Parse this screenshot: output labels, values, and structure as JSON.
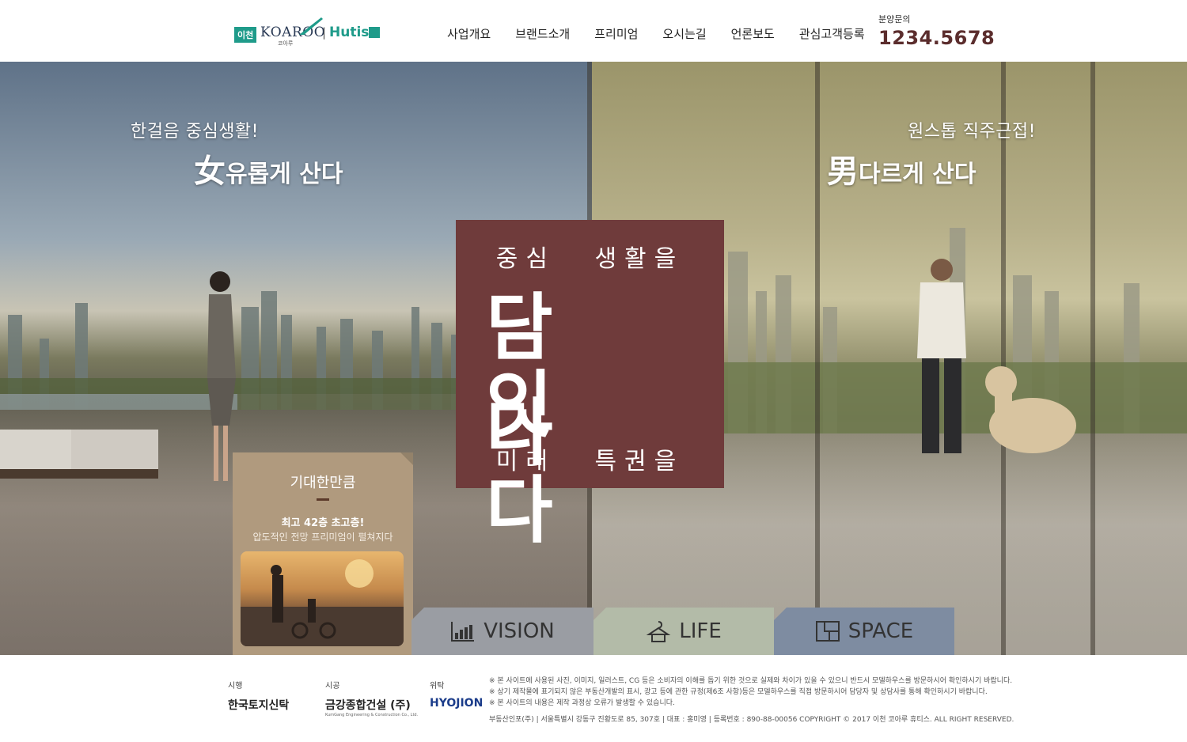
{
  "header": {
    "logo": {
      "city": "이천",
      "brand": "KOAROO",
      "brand_sub": "코아루",
      "separator": "|",
      "partner": "Hutis"
    },
    "nav": [
      "사업개요",
      "브랜드소개",
      "프리미엄",
      "오시는길",
      "언론보도",
      "관심고객등록"
    ],
    "contact_label": "분양문의",
    "contact_number": "1234.5678"
  },
  "hero": {
    "left": {
      "small": "한걸음 중심생활!",
      "big_char": "女",
      "big_rest": "유롭게 산다"
    },
    "right": {
      "small": "원스톱 직주근접!",
      "big_char": "男",
      "big_rest": "다르게 산다"
    },
    "center": {
      "line1": "중심 생활을",
      "big1": "담다",
      "big2": "잇다",
      "line4": "미래 특권을"
    },
    "promo": {
      "title": "기대한만큼",
      "headline": "최고 42층 초고층!",
      "desc": "압도적인 전망 프리미엄이 펼쳐지다"
    },
    "tabs": [
      {
        "label": "VISION",
        "icon": "chart-icon"
      },
      {
        "label": "LIFE",
        "icon": "hanger-icon"
      },
      {
        "label": "SPACE",
        "icon": "floorplan-icon"
      }
    ]
  },
  "footer": {
    "partners": [
      {
        "role": "시행",
        "name": "한국토지신탁"
      },
      {
        "role": "시공",
        "name": "금강종합건설 (주)",
        "sub": "KumGang Engineering & Construction Co., Ltd."
      },
      {
        "role": "위탁",
        "name": "HYOJION"
      }
    ],
    "notices": [
      "※ 본 사이트에 사용된 사진, 이미지, 일러스트, CG 등은 소비자의 이해를 돕기 위한 것으로 실제와 차이가 있을 수 있으니 반드시 모델하우스를 방문하시어 확인하시기 바랍니다.",
      "※ 상기 제작물에 표기되지 않은 부동산개발의 표시, 광고 등에 관한 규정(제6조 사항)등은 모델하우스를 직접 방문하시어 담당자 및 상담사를 통해 확인하시기 바랍니다.",
      "※ 본 사이트의 내용은 제작 과정상 오류가 발생할 수 있습니다."
    ],
    "info": "부동산인포(주)  |  서울특별시 강동구 진황도로 85, 307호  |  대표 : 홍미영  |  등록번호 : 890-88-00056      COPYRIGHT © 2017 이천 코아루 휴티스. ALL RIGHT RESERVED."
  }
}
